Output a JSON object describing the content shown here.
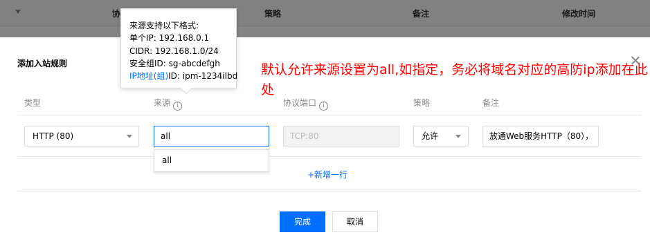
{
  "background_table": {
    "columns": [
      "协议端口",
      "策略",
      "备注",
      "修改时间"
    ]
  },
  "modal": {
    "title": "添加入站规则",
    "headers": {
      "type": "类型",
      "source": "来源",
      "protocol_port": "协议端口",
      "policy": "策略",
      "remark": "备注"
    },
    "row": {
      "type_value": "HTTP (80)",
      "source_value": "all",
      "protocol_port_value": "TCP:80",
      "policy_value": "允许",
      "remark_value": "放通Web服务HTTP（80），"
    },
    "dropdown_options": [
      "all"
    ],
    "add_row_label": "+新增一行",
    "confirm_label": "完成",
    "cancel_label": "取消"
  },
  "tooltip": {
    "line1": "来源支持以下格式:",
    "line2": "单个IP: 192.168.0.1",
    "line3": "CIDR: 192.168.1.0/24",
    "line4": "安全组ID: sg-abcdefgh",
    "line5_link": "IP地址(组)",
    "line5_rest": "ID: ipm-1234ilbd"
  },
  "annotation": "默认允许来源设置为all,如指定，务必将域名对应的高防ip添加在此处",
  "colors": {
    "accent": "#006eff",
    "annotation": "#ff0000"
  }
}
